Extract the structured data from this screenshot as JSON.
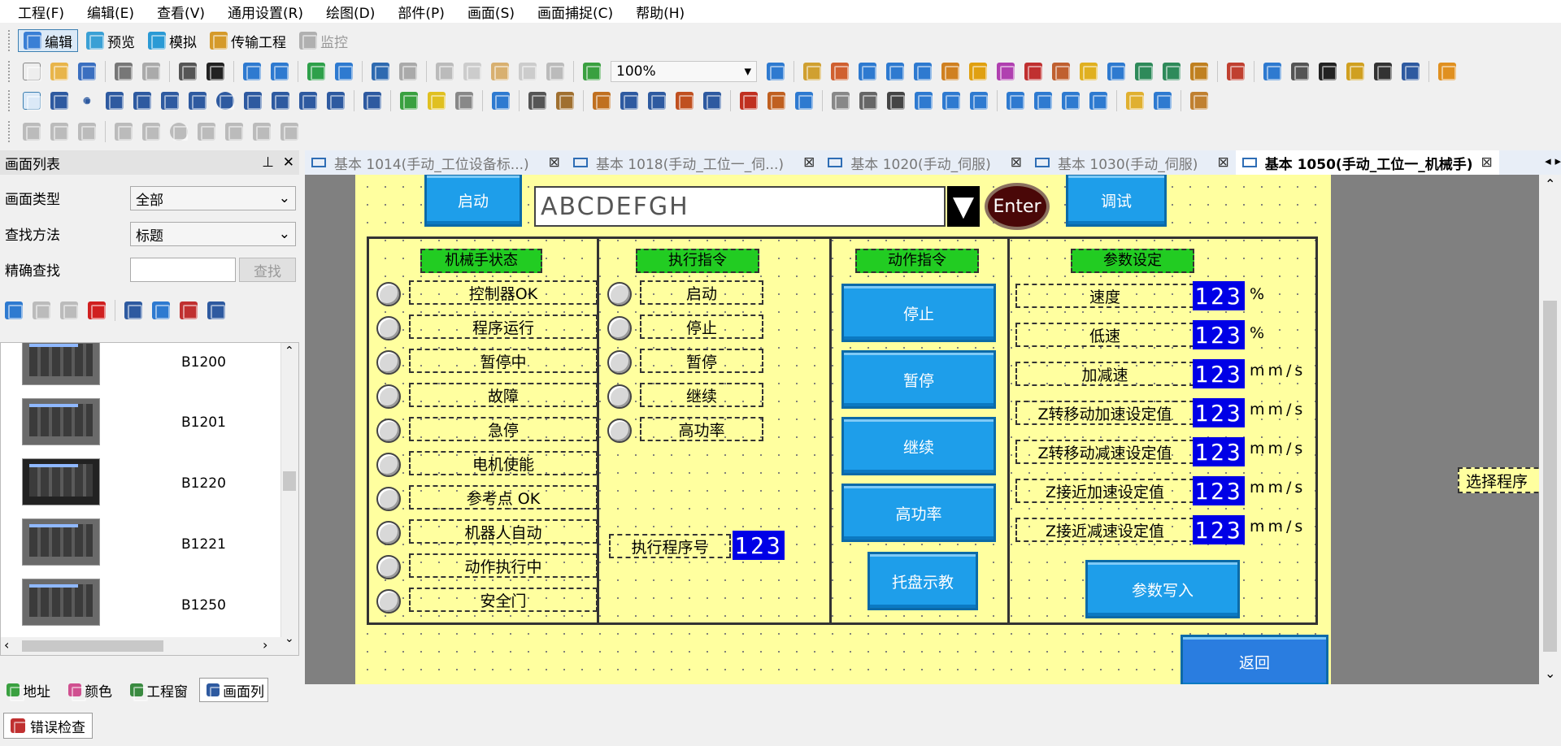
{
  "menu": [
    "工程(F)",
    "编辑(E)",
    "查看(V)",
    "通用设置(R)",
    "绘图(D)",
    "部件(P)",
    "画面(S)",
    "画面捕捉(C)",
    "帮助(H)"
  ],
  "modes": [
    {
      "label": "编辑",
      "color": "#3a7fd5"
    },
    {
      "label": "预览",
      "color": "#3aa0d5"
    },
    {
      "label": "模拟",
      "color": "#2a9ad5"
    },
    {
      "label": "传输工程",
      "color": "#d59a2a"
    },
    {
      "label": "监控",
      "color": "#b0b0b0"
    }
  ],
  "zoom": "100%",
  "left_panel": {
    "title": "画面列表",
    "type_label": "画面类型",
    "type_value": "全部",
    "method_label": "查找方法",
    "method_value": "标题",
    "exact_label": "精确查找",
    "search_button": "查找",
    "thumbnails": [
      "B1200",
      "B1201",
      "B1220",
      "B1221",
      "B1250"
    ],
    "tabs": [
      "地址",
      "颜色",
      "工程窗",
      "画面列"
    ]
  },
  "doc_tabs": [
    {
      "label": "基本 1014(手动_工位设备标...)",
      "active": false
    },
    {
      "label": "基本 1018(手动_工位一_伺...)",
      "active": false
    },
    {
      "label": "基本 1020(手动_伺服)",
      "active": false
    },
    {
      "label": "基本 1030(手动_伺服)",
      "active": false
    },
    {
      "label": "基本 1050(手动_工位一_机械手)",
      "active": true
    }
  ],
  "screen": {
    "start_button": "启动",
    "text_input": "ABCDEFGH",
    "enter_button": "Enter",
    "debug_button": "调试",
    "robot_status": {
      "caption": "机械手状态",
      "items": [
        "控制器OK",
        "程序运行",
        "暂停中",
        "故障",
        "急停",
        "电机使能",
        "参考点 OK",
        "机器人自动",
        "动作执行中",
        "安全门"
      ]
    },
    "exec_cmd": {
      "caption": "执行指令",
      "items": [
        "启动",
        "停止",
        "暂停",
        "继续",
        "高功率"
      ],
      "prog_label": "执行程序号",
      "prog_value": "123"
    },
    "action_cmd": {
      "caption": "动作指令",
      "buttons": [
        "停止",
        "暂停",
        "继续",
        "高功率"
      ],
      "tray_button": "托盘示教"
    },
    "params": {
      "caption": "参数设定",
      "rows": [
        {
          "label": "速度",
          "value": "123",
          "unit": "%"
        },
        {
          "label": "低速",
          "value": "123",
          "unit": "%"
        },
        {
          "label": "加减速",
          "value": "123",
          "unit": "mm/s"
        },
        {
          "label": "Z转移动加速设定值",
          "value": "123",
          "unit": "mm/s"
        },
        {
          "label": "Z转移动减速设定值",
          "value": "123",
          "unit": "mm/s"
        },
        {
          "label": "Z接近加速设定值",
          "value": "123",
          "unit": "mm/s"
        },
        {
          "label": "Z接近减速设定值",
          "value": "123",
          "unit": "mm/s"
        }
      ],
      "write_button": "参数写入"
    },
    "return_button": "返回",
    "side_label": "选择程序"
  },
  "error_tab": "错误检查"
}
